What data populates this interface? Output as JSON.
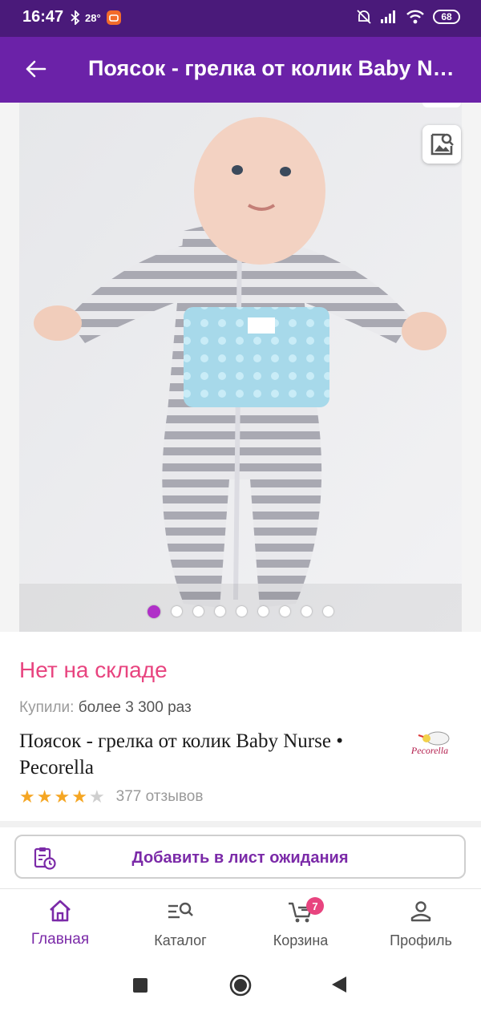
{
  "status_bar": {
    "time": "16:47",
    "temperature": "28°",
    "battery": "68"
  },
  "app_bar": {
    "title": "Поясок - грелка от колик Baby Nurse • Pecorella"
  },
  "gallery": {
    "image_count": 9,
    "active_index": 0
  },
  "product": {
    "stock_status": "Нет на складе",
    "bought_label": "Купили:",
    "bought_value": "более 3 300 раз",
    "title": "Поясок - грелка от колик Baby Nurse • Pecorella",
    "brand_logo_text": "Pecorella",
    "rating": 4,
    "rating_max": 5,
    "reviews": "377 отзывов"
  },
  "actions": {
    "waitlist_label": "Добавить в лист ожидания"
  },
  "bottom_nav": {
    "items": [
      {
        "label": "Главная",
        "icon": "home-icon",
        "active": true
      },
      {
        "label": "Каталог",
        "icon": "catalog-search-icon",
        "active": false
      },
      {
        "label": "Корзина",
        "icon": "cart-icon",
        "active": false,
        "badge": "7"
      },
      {
        "label": "Профиль",
        "icon": "profile-icon",
        "active": false
      }
    ]
  },
  "colors": {
    "status_bar": "#4a1a7a",
    "app_bar": "#6b22a8",
    "accent": "#7b2aa8",
    "out_of_stock": "#e8447f",
    "star": "#f5a623"
  }
}
